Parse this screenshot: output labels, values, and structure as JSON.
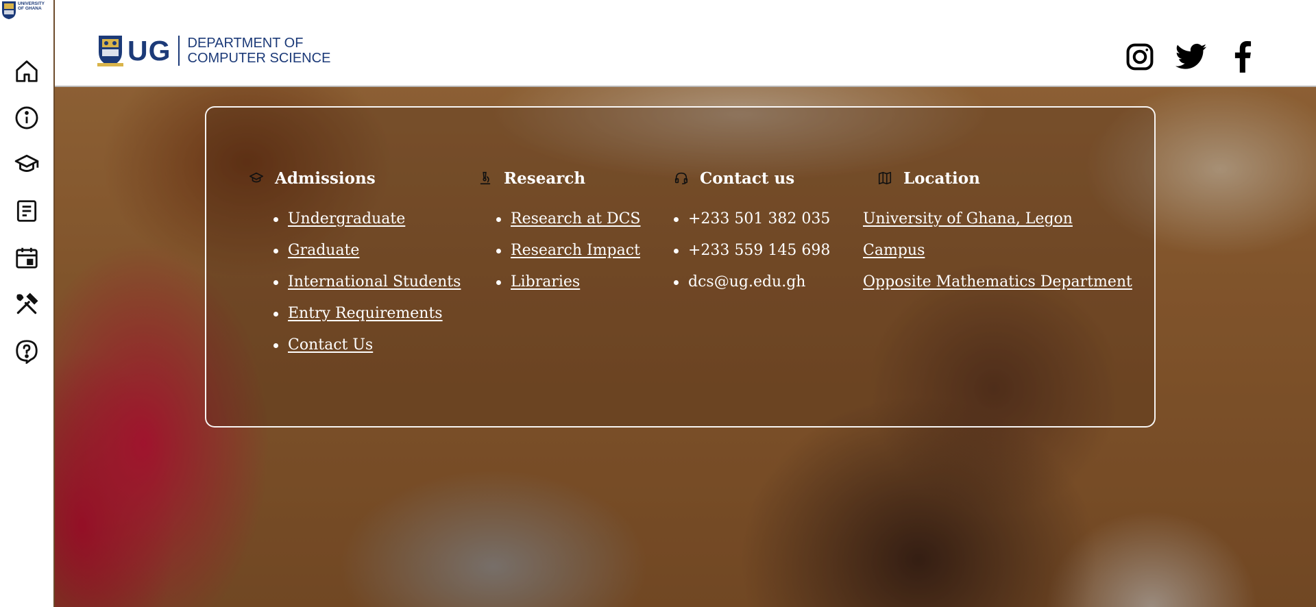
{
  "rail": {
    "logo_text": "UNIVERSITY OF GHANA",
    "items": [
      {
        "name": "home",
        "icon": "home-icon"
      },
      {
        "name": "about",
        "icon": "info-icon"
      },
      {
        "name": "academics",
        "icon": "graduation-cap-icon"
      },
      {
        "name": "news",
        "icon": "document-icon"
      },
      {
        "name": "events",
        "icon": "calendar-icon"
      },
      {
        "name": "services",
        "icon": "tools-icon"
      },
      {
        "name": "help",
        "icon": "help-circle-icon"
      }
    ]
  },
  "header": {
    "brand_short": "UG",
    "dept_line1": "DEPARTMENT OF",
    "dept_line2": "COMPUTER SCIENCE",
    "brand_color": "#1c3a78",
    "social": [
      "instagram-icon",
      "twitter-icon",
      "facebook-icon"
    ]
  },
  "panel": {
    "admissions": {
      "title": "Admissions",
      "icon": "graduation-cap-icon",
      "links": [
        "Undergraduate",
        "Graduate",
        "International Students",
        "Entry Requirements",
        "Contact Us"
      ]
    },
    "research": {
      "title": "Research",
      "icon": "microscope-icon",
      "links": [
        "Research at DCS",
        "Research Impact",
        "Libraries"
      ]
    },
    "contact": {
      "title": "Contact us",
      "icon": "headset-icon",
      "items": [
        "+233 501 382 035",
        "+233 559 145 698",
        "dcs@ug.edu.gh"
      ]
    },
    "location": {
      "title": "Location",
      "icon": "map-icon",
      "lines": [
        "University of Ghana, Legon",
        "Campus",
        "Opposite Mathematics Department"
      ]
    }
  }
}
